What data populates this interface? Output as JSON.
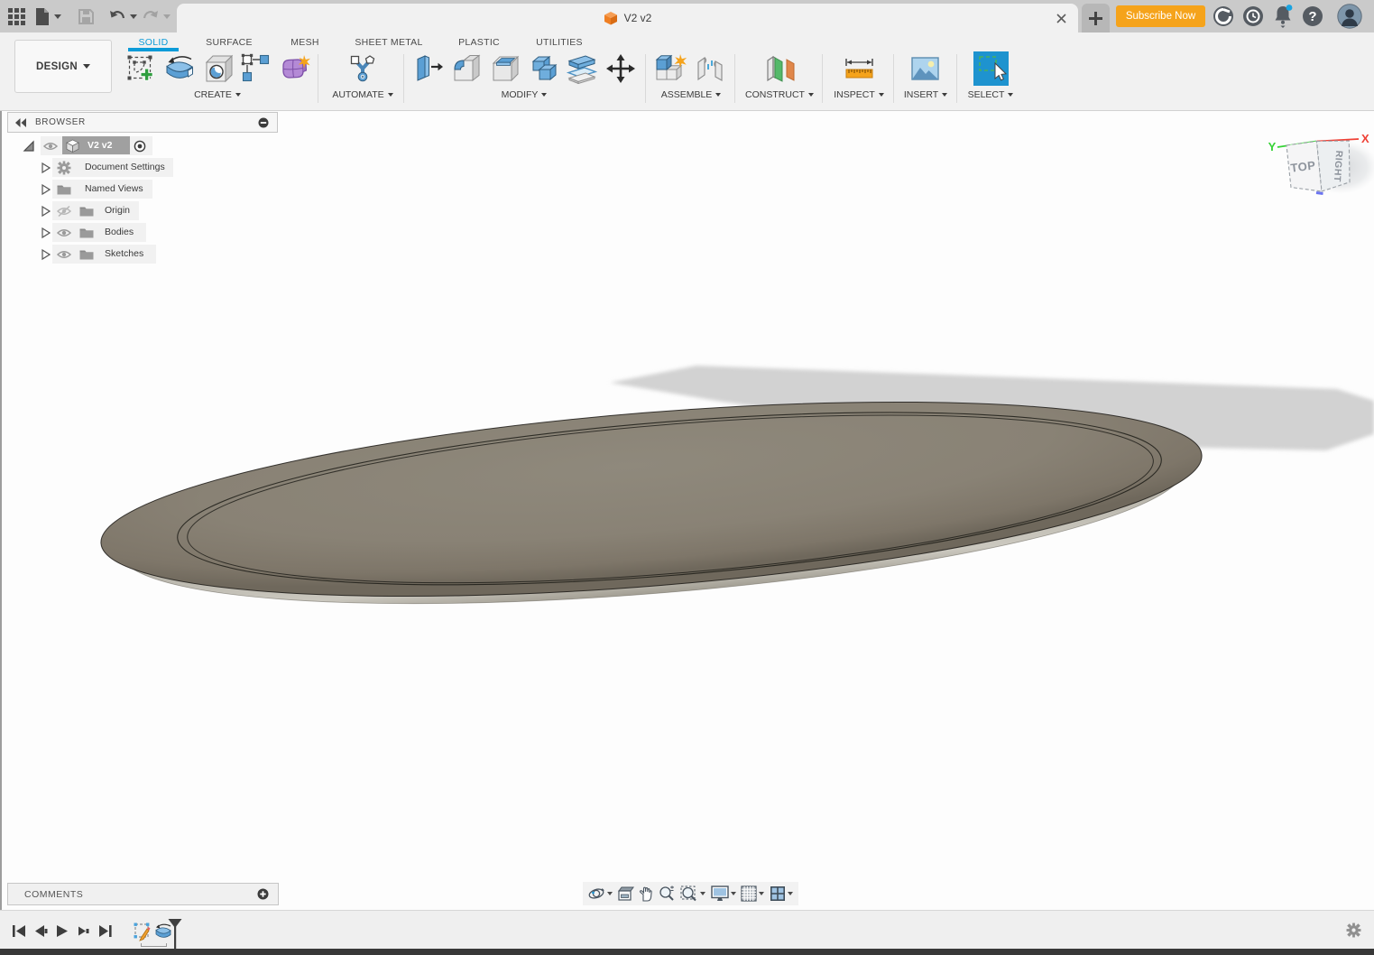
{
  "titlebar": {
    "tab_title": "V2 v2",
    "subscribe_label": "Subscribe Now",
    "help_glyph": "?",
    "icons": [
      "app-grid-icon",
      "file-new-icon",
      "save-icon",
      "undo-icon",
      "redo-icon",
      "job-status-icon",
      "history-icon",
      "notifications-icon",
      "help-icon",
      "avatar"
    ]
  },
  "ribbon": {
    "design_label": "DESIGN",
    "tabs": [
      "SOLID",
      "SURFACE",
      "MESH",
      "SHEET METAL",
      "PLASTIC",
      "UTILITIES"
    ],
    "active_tab": "SOLID",
    "groups": [
      "CREATE",
      "AUTOMATE",
      "MODIFY",
      "ASSEMBLE",
      "CONSTRUCT",
      "INSPECT",
      "INSERT",
      "SELECT"
    ],
    "tools": [
      "create-sketch",
      "revolve",
      "hole",
      "rectangular-pattern",
      "create-form",
      "automate",
      "press-pull",
      "fillet",
      "shell",
      "combine",
      "split-body",
      "move-copy",
      "new-component",
      "joint",
      "construction-plane",
      "measure",
      "insert-image",
      "select"
    ]
  },
  "browser": {
    "header": "BROWSER",
    "root_label": "V2 v2",
    "items": [
      {
        "label": "Document Settings",
        "icon": "gear-icon",
        "visibility": "none"
      },
      {
        "label": "Named Views",
        "icon": "folder-icon",
        "visibility": "none"
      },
      {
        "label": "Origin",
        "icon": "folder-icon",
        "visibility": "hidden"
      },
      {
        "label": "Bodies",
        "icon": "folder-icon",
        "visibility": "visible"
      },
      {
        "label": "Sketches",
        "icon": "folder-icon",
        "visibility": "visible"
      }
    ]
  },
  "viewcube": {
    "top_face": "TOP",
    "right_face": "RIGHT",
    "axis_x": "X",
    "axis_y": "Y"
  },
  "comments": {
    "label": "COMMENTS"
  },
  "colors": {
    "accent_blue": "#0c9bd8",
    "subscribe_orange": "#f5a31b",
    "select_blue": "#1e93cf",
    "axis_x_red": "#ef4136",
    "axis_y_green": "#37d337",
    "model_gray": "#8b8578"
  }
}
